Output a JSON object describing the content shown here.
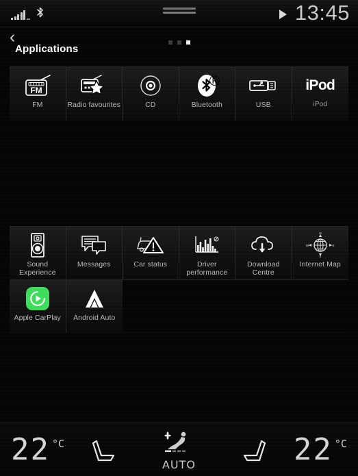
{
  "status_bar": {
    "signal_icon": "signal-bars-icon",
    "bluetooth_icon": "bluetooth-icon",
    "bluetooth_glyph": "ᛒ",
    "drag_handle_icon": "drag-handle-icon",
    "media_play_icon": "play-icon",
    "clock": "13:45"
  },
  "title_bar": {
    "back_icon": "‹",
    "title": "Applications",
    "pages": {
      "total": 3,
      "active_index": 2
    }
  },
  "media_panel": {
    "items": [
      {
        "label": "FM",
        "icon": "fm-radio-icon",
        "icon_text": "FM"
      },
      {
        "label": "Radio favourites",
        "icon": "radio-favourites-icon",
        "icon_text": ""
      },
      {
        "label": "CD",
        "icon": "cd-disc-icon",
        "icon_text": ""
      },
      {
        "label": "Bluetooth",
        "icon": "bluetooth-icon",
        "icon_text": "ᛒ"
      },
      {
        "label": "USB",
        "icon": "usb-connector-icon",
        "icon_text": ""
      },
      {
        "label": "iPod",
        "icon": "ipod-wordmark-icon",
        "icon_text": "iPod"
      }
    ]
  },
  "apps_panel": {
    "items": [
      {
        "label": "Sound Experience",
        "icon": "speaker-icon"
      },
      {
        "label": "Messages",
        "icon": "messages-bubble-icon"
      },
      {
        "label": "Car status",
        "icon": "car-warning-icon"
      },
      {
        "label": "Driver performance",
        "icon": "bar-chart-icon"
      },
      {
        "label": "Download Centre",
        "icon": "cloud-download-icon"
      },
      {
        "label": "Internet Map",
        "icon": "globe-compass-icon"
      },
      {
        "label": "Apple CarPlay",
        "icon": "apple-carplay-icon"
      },
      {
        "label": "Android Auto",
        "icon": "android-auto-icon"
      }
    ]
  },
  "climate_bar": {
    "left_temperature": "22",
    "left_unit": "°C",
    "right_temperature": "22",
    "right_unit": "°C",
    "left_seat_icon": "seat-left-icon",
    "right_seat_icon": "seat-right-icon",
    "auto_icon": "auto-climate-icon",
    "auto_label": "AUTO"
  },
  "colors": {
    "background": "#050505",
    "panel": "#1a1a1a",
    "text_primary": "#ffffff",
    "text_secondary": "#b9b9b9",
    "clock": "#c9c9c9",
    "carplay_green": "#3ddc5b"
  }
}
